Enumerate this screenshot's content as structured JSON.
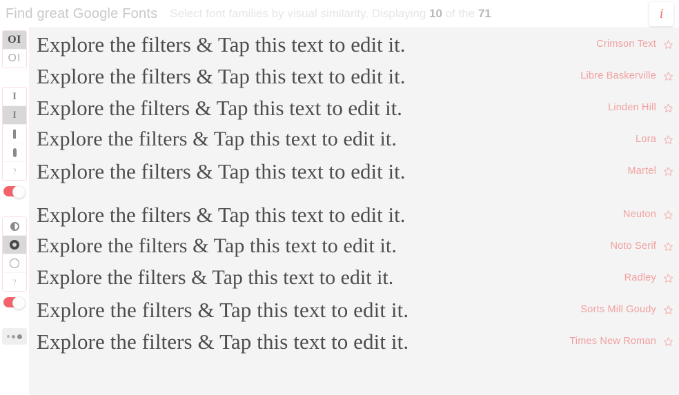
{
  "header": {
    "title": "Find great Google Fonts",
    "subtitle_prefix": "Select font families by visual similarity.",
    "subtitle_displaying": "Displaying",
    "count_shown": "10",
    "subtitle_of_the": "of the",
    "count_total": "71",
    "info_label": "i",
    "info_icon": "info-icon"
  },
  "colors": {
    "accent": "#f4636b",
    "font_name": "#f2a0a0",
    "info": "#f26b6b",
    "panel_bg": "#f4f4f4",
    "sample_text": "#4d4d4d",
    "title": "#c9c9c9",
    "subtitle": "#e6e6e6"
  },
  "sidebar": {
    "groups": [
      {
        "name": "serif-style-filter",
        "items": [
          {
            "label": "OI",
            "icon": "serif-letters-icon",
            "style": "serif-bold",
            "selected": true
          },
          {
            "label": "OI",
            "icon": "sans-letters-icon",
            "style": "sans-thin",
            "selected": false
          }
        ]
      },
      {
        "name": "stem-serif-filter",
        "items": [
          {
            "label": "I",
            "icon": "slab-serif-i-icon",
            "style": "glyph-I",
            "selected": false
          },
          {
            "label": "I",
            "icon": "serif-i-icon",
            "style": "glyph-I",
            "selected": true
          },
          {
            "label": "",
            "icon": "plain-stem-icon",
            "style": "bar-plain",
            "selected": false
          },
          {
            "label": "",
            "icon": "rounded-stem-icon",
            "style": "bar-round",
            "selected": false
          },
          {
            "label": "?",
            "icon": "unknown-serif-icon",
            "style": "glyph-q",
            "selected": false
          }
        ],
        "toggle": {
          "name": "serif-filter-toggle",
          "on": true
        }
      },
      {
        "name": "contrast-filter",
        "items": [
          {
            "label": "",
            "icon": "half-contrast-o-icon",
            "style": "o-half",
            "selected": false
          },
          {
            "label": "",
            "icon": "high-contrast-o-icon",
            "style": "o-bold",
            "selected": true
          },
          {
            "label": "",
            "icon": "low-contrast-o-icon",
            "style": "o-thin",
            "selected": false
          },
          {
            "label": "?",
            "icon": "unknown-contrast-icon",
            "style": "glyph-q",
            "selected": false
          }
        ],
        "toggle": {
          "name": "contrast-filter-toggle",
          "on": true
        }
      }
    ],
    "more_button": {
      "name": "more-options-button",
      "icon": "size-dots-icon"
    }
  },
  "main": {
    "sample_text": "Explore the filters & Tap this text to edit it.",
    "star_icon": "star-outline-icon",
    "rows": [
      {
        "font": "Crimson Text",
        "group": 1
      },
      {
        "font": "Libre Baskerville",
        "group": 1
      },
      {
        "font": "Linden Hill",
        "group": 1
      },
      {
        "font": "Lora",
        "group": 1
      },
      {
        "font": "Martel",
        "group": 1
      },
      {
        "font": "Neuton",
        "group": 2
      },
      {
        "font": "Noto Serif",
        "group": 2
      },
      {
        "font": "Radley",
        "group": 2
      },
      {
        "font": "Sorts Mill Goudy",
        "group": 2
      },
      {
        "font": "Times New Roman",
        "group": 2
      }
    ]
  }
}
